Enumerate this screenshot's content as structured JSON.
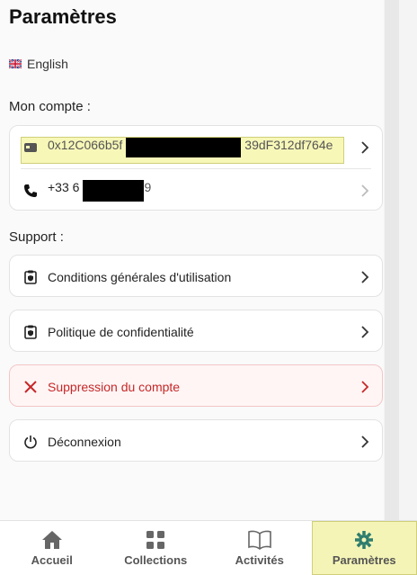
{
  "header": {
    "title": "Paramètres"
  },
  "language": {
    "label": "English",
    "flag_icon": "uk-flag-icon"
  },
  "account": {
    "title": "Mon compte :",
    "wallet_prefix": "0x12C066b5f",
    "wallet_suffix": "39dF312df764e",
    "phone_prefix": "+33 6",
    "phone_suffix": "9"
  },
  "support": {
    "title": "Support :",
    "items": [
      {
        "label": "Conditions générales d'utilisation",
        "icon": "clipboard-shield-icon"
      },
      {
        "label": "Politique de confidentialité",
        "icon": "clipboard-shield-icon"
      },
      {
        "label": "Suppression du compte",
        "icon": "close-icon"
      },
      {
        "label": "Déconnexion",
        "icon": "power-icon"
      }
    ]
  },
  "nav": {
    "items": [
      {
        "label": "Accueil",
        "icon": "home-icon"
      },
      {
        "label": "Collections",
        "icon": "grid-icon"
      },
      {
        "label": "Activités",
        "icon": "book-icon"
      },
      {
        "label": "Paramètres",
        "icon": "gear-icon"
      }
    ]
  },
  "colors": {
    "danger": "#c62828",
    "highlight": "#f4f4b6",
    "accent": "#2e7d6e"
  }
}
